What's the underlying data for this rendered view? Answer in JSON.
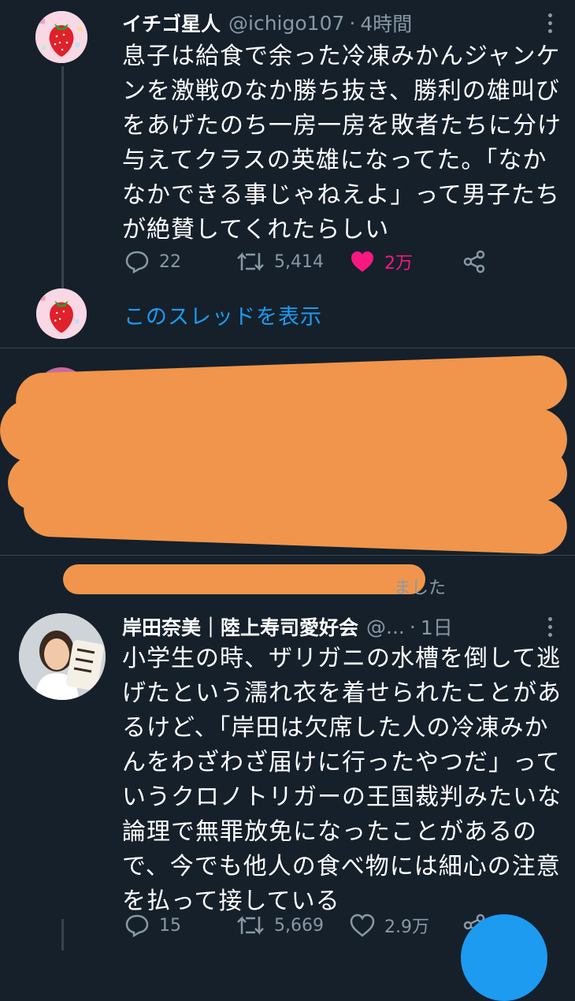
{
  "tweet1": {
    "name": "イチゴ星人",
    "handle": "@ichigo107",
    "separator": "·",
    "time": "4時間",
    "text": "息子は給食で余った冷凍みかんジャンケ\nンを激戦のなか勝ち抜き、勝利の雄叫び\nをあげたのち一房一房を敗者たちに分け\n与えてクラスの英雄になってた。「なか\nなかできる事じゃねえよ」って男子たち\nが絶賛してくれたらしい",
    "replies": "22",
    "retweets": "5,414",
    "likes": "2万",
    "like_color": "#f91880"
  },
  "show_thread": {
    "label": "このスレッドを表示"
  },
  "retweet_note": {
    "text": "ました"
  },
  "tweet3": {
    "name": "岸田奈美｜陸上寿司愛好会",
    "handle": "@...",
    "separator": "·",
    "time": "1日",
    "text": "小学生の時、ザリガニの水槽を倒して逃\nげたという濡れ衣を着せられたことがあ\nるけど、「岸田は欠席した人の冷凍みか\nんをわざわざ届けに行ったやつだ」って\nいうクロノトリガーの王国裁判みたいな\n論理で無罪放免になったことがあるの\nで、今でも他人の食べ物には細心の注意\nを払って接している",
    "replies": "15",
    "retweets": "5,669",
    "likes": "2.9万"
  },
  "icons": {
    "reply": "reply-icon",
    "retweet": "retweet-icon",
    "like": "heart-icon",
    "share": "share-icon",
    "more": "more-icon",
    "compose": "compose-fab"
  },
  "colors": {
    "background": "#15202b",
    "accent": "#1d9bf0",
    "muted": "#8899a6",
    "redaction": "#f0954b"
  }
}
